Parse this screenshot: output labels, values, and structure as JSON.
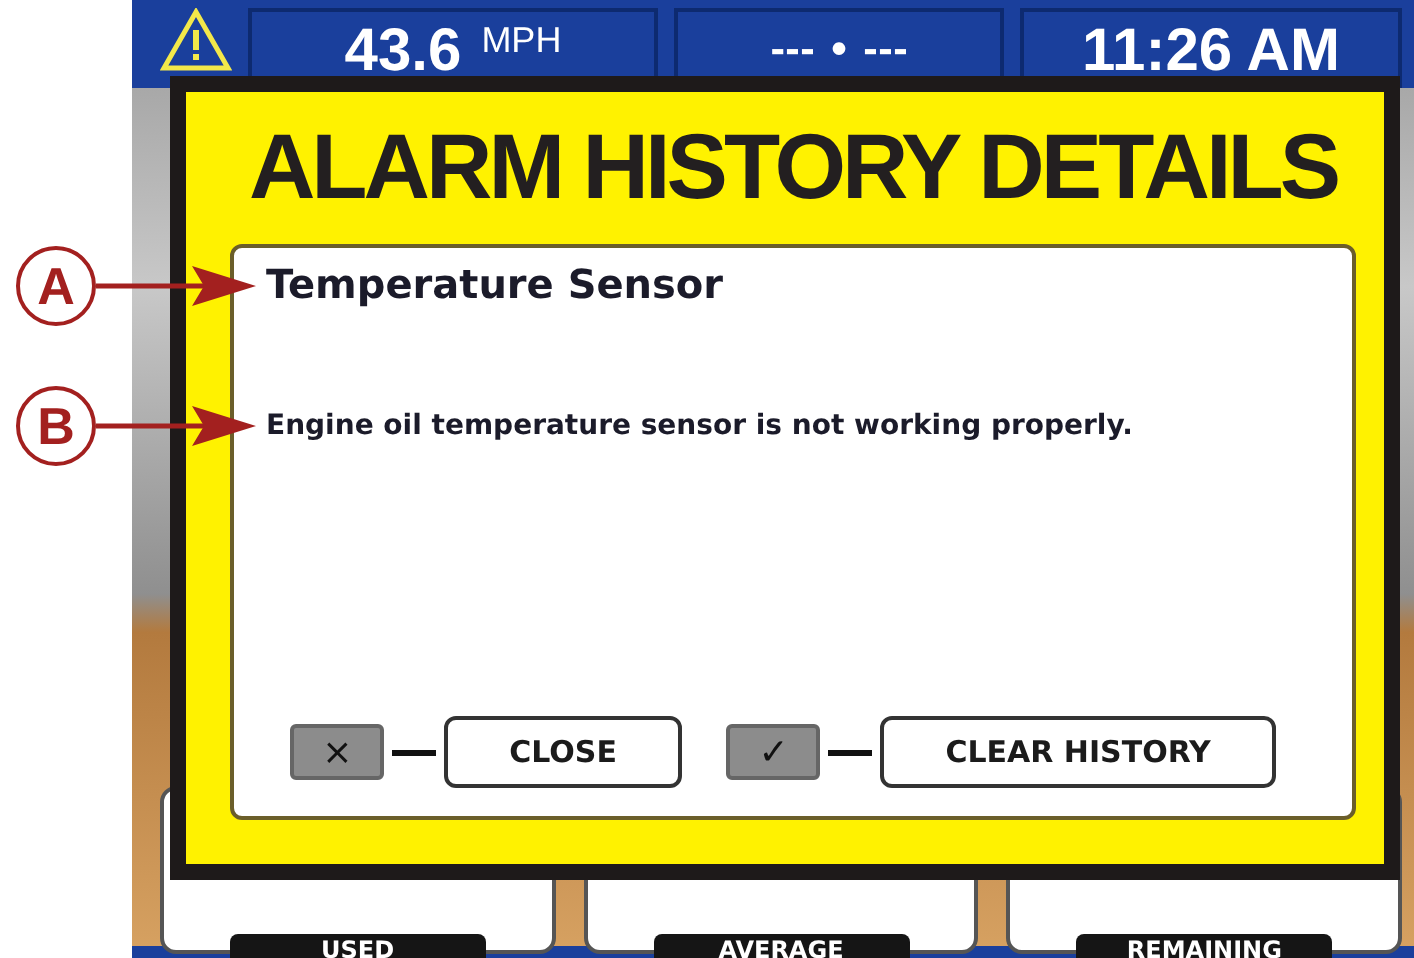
{
  "status_bar": {
    "speed": "43.6",
    "speed_unit": "MPH",
    "heading": "--- • ---",
    "time": "11:26 AM"
  },
  "gauges": [
    {
      "label": "USED"
    },
    {
      "label": "AVERAGE"
    },
    {
      "label": "REMAINING"
    }
  ],
  "dialog": {
    "title": "ALARM HISTORY DETAILS",
    "alarm_name": "Temperature Sensor",
    "message": "Engine oil temperature sensor is not working properly.",
    "buttons": [
      {
        "key": "×",
        "label": "CLOSE"
      },
      {
        "key": "✓",
        "label": "CLEAR HISTORY"
      }
    ]
  },
  "callouts": [
    {
      "label": "A"
    },
    {
      "label": "B"
    }
  ]
}
